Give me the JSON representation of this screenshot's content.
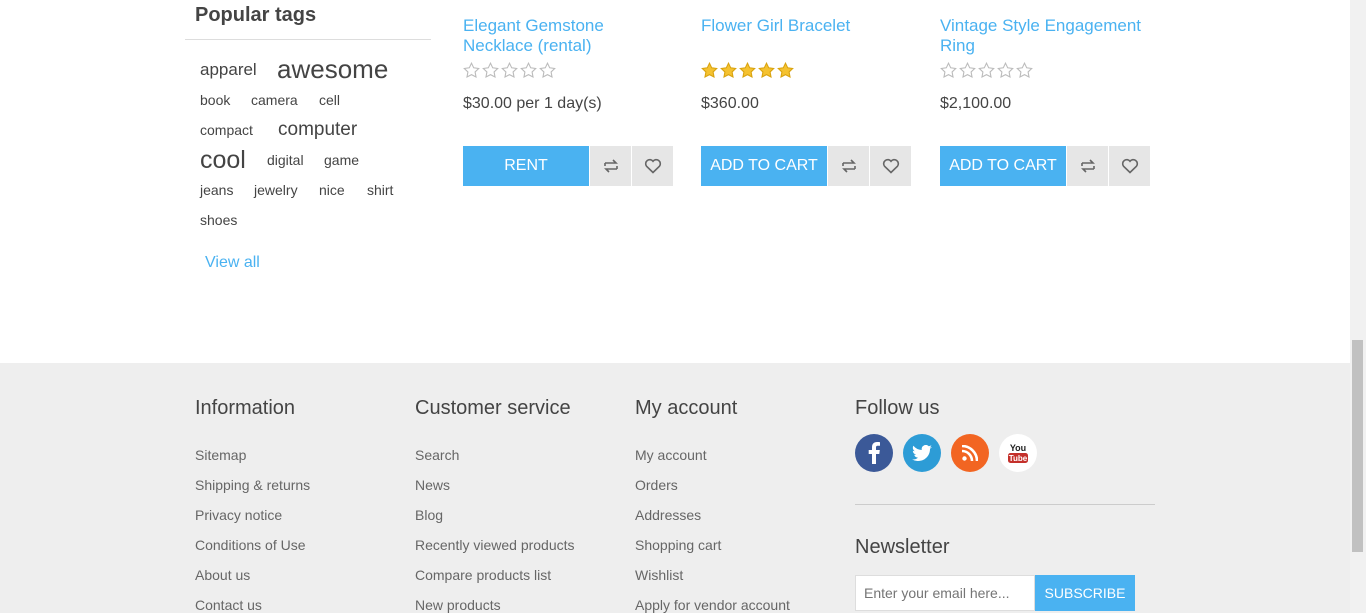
{
  "tags": {
    "title": "Popular tags",
    "items": [
      {
        "label": "apparel"
      },
      {
        "label": "awesome"
      },
      {
        "label": "book"
      },
      {
        "label": "camera"
      },
      {
        "label": "cell"
      },
      {
        "label": "compact"
      },
      {
        "label": "computer"
      },
      {
        "label": "cool"
      },
      {
        "label": "digital"
      },
      {
        "label": "game"
      },
      {
        "label": "jeans"
      },
      {
        "label": "jewelry"
      },
      {
        "label": "nice"
      },
      {
        "label": "shirt"
      },
      {
        "label": "shoes"
      }
    ],
    "view_all": "View all"
  },
  "products": [
    {
      "title": "Elegant Gemstone Necklace (rental)",
      "rating": 0,
      "price": "$30.00 per 1 day(s)",
      "button": "RENT"
    },
    {
      "title": "Flower Girl Bracelet",
      "rating": 5,
      "price": "$360.00",
      "button": "ADD TO CART"
    },
    {
      "title": "Vintage Style Engagement Ring",
      "rating": 0,
      "price": "$2,100.00",
      "button": "ADD TO CART"
    }
  ],
  "footer": {
    "information": {
      "title": "Information",
      "links": [
        "Sitemap",
        "Shipping & returns",
        "Privacy notice",
        "Conditions of Use",
        "About us",
        "Contact us"
      ]
    },
    "customer_service": {
      "title": "Customer service",
      "links": [
        "Search",
        "News",
        "Blog",
        "Recently viewed products",
        "Compare products list",
        "New products"
      ]
    },
    "my_account": {
      "title": "My account",
      "links": [
        "My account",
        "Orders",
        "Addresses",
        "Shopping cart",
        "Wishlist",
        "Apply for vendor account"
      ]
    },
    "follow_us": {
      "title": "Follow us",
      "networks": [
        "facebook-icon",
        "twitter-icon",
        "rss-icon",
        "youtube-icon"
      ],
      "youtube_text": {
        "top": "You",
        "bottom": "Tube"
      }
    },
    "newsletter": {
      "title": "Newsletter",
      "placeholder": "Enter your email here...",
      "button": "SUBSCRIBE"
    }
  },
  "colors": {
    "accent": "#4ab2f1",
    "footer_bg": "#eeeeee",
    "facebook": "#3b5998",
    "twitter": "#2d9cd6",
    "rss": "#f26522"
  }
}
